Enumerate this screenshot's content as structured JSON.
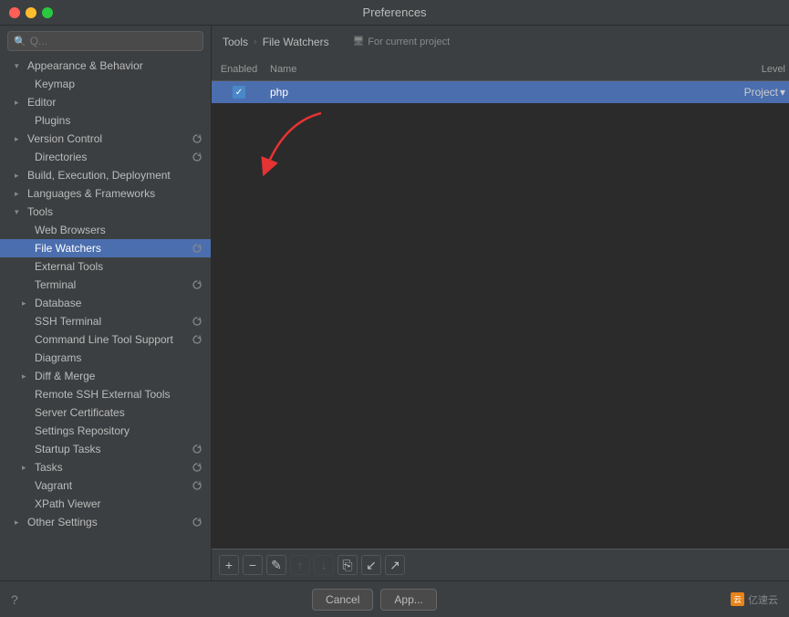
{
  "window": {
    "title": "Preferences"
  },
  "search": {
    "placeholder": "Q..."
  },
  "breadcrumb": {
    "root": "Tools",
    "separator": "›",
    "current": "File Watchers",
    "project_label": "For current project"
  },
  "table": {
    "columns": {
      "enabled": "Enabled",
      "name": "Name",
      "level": "Level"
    },
    "rows": [
      {
        "enabled": true,
        "name": "php",
        "level": "Project"
      }
    ]
  },
  "sidebar": {
    "items": [
      {
        "id": "appearance",
        "label": "Appearance & Behavior",
        "indent": 0,
        "expanded": true,
        "has_arrow": true,
        "badge": false
      },
      {
        "id": "keymap",
        "label": "Keymap",
        "indent": 1,
        "has_arrow": false,
        "badge": false
      },
      {
        "id": "editor",
        "label": "Editor",
        "indent": 0,
        "has_arrow": true,
        "badge": false
      },
      {
        "id": "plugins",
        "label": "Plugins",
        "indent": 1,
        "has_arrow": false,
        "badge": false
      },
      {
        "id": "version-control",
        "label": "Version Control",
        "indent": 0,
        "has_arrow": true,
        "badge": true
      },
      {
        "id": "directories",
        "label": "Directories",
        "indent": 1,
        "has_arrow": false,
        "badge": true
      },
      {
        "id": "build",
        "label": "Build, Execution, Deployment",
        "indent": 0,
        "has_arrow": true,
        "badge": false
      },
      {
        "id": "languages",
        "label": "Languages & Frameworks",
        "indent": 0,
        "has_arrow": true,
        "badge": false
      },
      {
        "id": "tools",
        "label": "Tools",
        "indent": 0,
        "has_arrow": true,
        "expanded": true,
        "badge": false
      },
      {
        "id": "web-browsers",
        "label": "Web Browsers",
        "indent": 1,
        "has_arrow": false,
        "badge": false
      },
      {
        "id": "file-watchers",
        "label": "File Watchers",
        "indent": 1,
        "has_arrow": false,
        "badge": true,
        "selected": true
      },
      {
        "id": "external-tools",
        "label": "External Tools",
        "indent": 1,
        "has_arrow": false,
        "badge": false
      },
      {
        "id": "terminal",
        "label": "Terminal",
        "indent": 1,
        "has_arrow": false,
        "badge": true
      },
      {
        "id": "database",
        "label": "Database",
        "indent": 1,
        "has_arrow": true,
        "badge": false
      },
      {
        "id": "ssh-terminal",
        "label": "SSH Terminal",
        "indent": 1,
        "has_arrow": false,
        "badge": true
      },
      {
        "id": "cmd-tool",
        "label": "Command Line Tool Support",
        "indent": 1,
        "has_arrow": false,
        "badge": true
      },
      {
        "id": "diagrams",
        "label": "Diagrams",
        "indent": 1,
        "has_arrow": false,
        "badge": false
      },
      {
        "id": "diff-merge",
        "label": "Diff & Merge",
        "indent": 1,
        "has_arrow": true,
        "badge": false
      },
      {
        "id": "remote-ssh",
        "label": "Remote SSH External Tools",
        "indent": 1,
        "has_arrow": false,
        "badge": false
      },
      {
        "id": "server-certs",
        "label": "Server Certificates",
        "indent": 1,
        "has_arrow": false,
        "badge": false
      },
      {
        "id": "settings-repo",
        "label": "Settings Repository",
        "indent": 1,
        "has_arrow": false,
        "badge": false
      },
      {
        "id": "startup-tasks",
        "label": "Startup Tasks",
        "indent": 1,
        "has_arrow": false,
        "badge": true
      },
      {
        "id": "tasks",
        "label": "Tasks",
        "indent": 1,
        "has_arrow": true,
        "badge": true
      },
      {
        "id": "vagrant",
        "label": "Vagrant",
        "indent": 1,
        "has_arrow": false,
        "badge": true
      },
      {
        "id": "xpath-viewer",
        "label": "XPath Viewer",
        "indent": 1,
        "has_arrow": false,
        "badge": false
      },
      {
        "id": "other-settings",
        "label": "Other Settings",
        "indent": 0,
        "has_arrow": true,
        "badge": true
      }
    ]
  },
  "toolbar": {
    "add": "+",
    "remove": "−",
    "edit": "✎",
    "up": "↑",
    "down": "↓",
    "copy": "⎘",
    "import": "↙",
    "export": "↗"
  },
  "footer": {
    "cancel_label": "Cancel",
    "apply_label": "App...",
    "watermark": "亿速云"
  }
}
